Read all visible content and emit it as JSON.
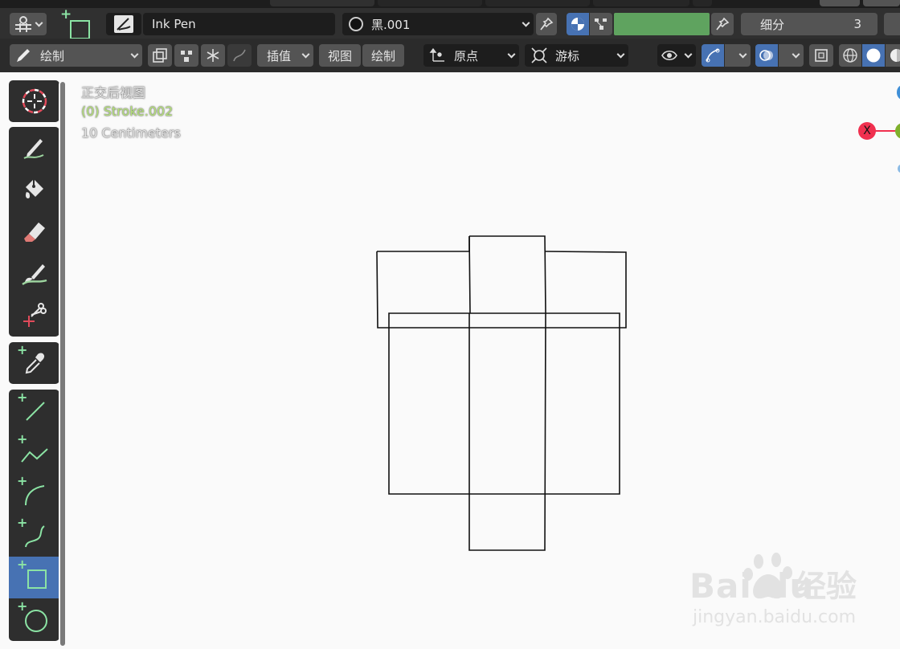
{
  "header": {
    "brush_name": "Ink Pen",
    "material_name": "黑.001",
    "subdivision_label": "细分",
    "subdivision_value": "3"
  },
  "toolbar": {
    "mode_label": "绘制",
    "interp_label": "插值",
    "view_menu": "视图",
    "draw_menu": "绘制",
    "origin_label": "原点",
    "cursor_label": "游标"
  },
  "viewport": {
    "view_name": "正交后视图",
    "object_name": "(0) Stroke.002",
    "scale_text": "10 Centimeters",
    "axis_x": "X"
  },
  "watermark": {
    "brand": "Bai du",
    "site_name": "经验",
    "url": "jingyan.baidu.com"
  },
  "colors": {
    "accent_blue": "#4772b3",
    "color_swatch": "#5fa35f",
    "axis_x": "#f0304f",
    "axis_y": "#7fb02c",
    "active_tool": "#4772b3"
  },
  "left_tools": [
    "cursor-tool",
    "draw-tool",
    "fill-tool",
    "erase-tool",
    "tint-tool",
    "cutter-tool",
    "eyedropper-tool",
    "line-tool",
    "polyline-tool",
    "arc-tool",
    "curve-tool",
    "box-tool",
    "circle-tool"
  ],
  "active_tool": "box-tool"
}
